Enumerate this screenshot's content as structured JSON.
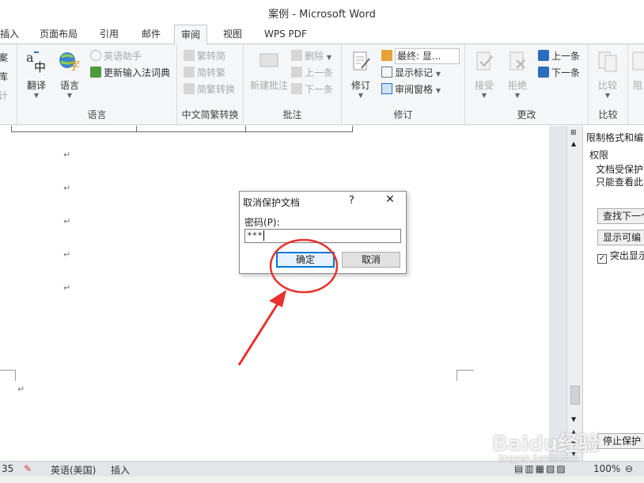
{
  "window": {
    "title": "案例 - Microsoft Word"
  },
  "tabs": [
    {
      "label": "插入"
    },
    {
      "label": "页面布局"
    },
    {
      "label": "引用"
    },
    {
      "label": "邮件"
    },
    {
      "label": "审阅"
    },
    {
      "label": "视图"
    },
    {
      "label": "WPS PDF"
    }
  ],
  "ribbon": {
    "left_cut": [
      "案",
      "库",
      "计"
    ],
    "language": {
      "label": "语言",
      "translate": "翻译",
      "language_btn": "语言",
      "english_assistant": "英语助手",
      "update_ime": "更新输入法词典"
    },
    "chinese": {
      "label": "中文简繁转换",
      "to_trad": "繁转简",
      "to_simp": "简转繁",
      "convert": "简繁转换"
    },
    "comments": {
      "label": "批注",
      "new": "新建批注",
      "delete": "删除",
      "prev": "上一条",
      "next": "下一条"
    },
    "tracking": {
      "label": "修订",
      "track": "修订",
      "display": "最终: 显...",
      "show_markup": "显示标记",
      "review_pane": "审阅窗格"
    },
    "changes": {
      "label": "更改",
      "accept": "接受",
      "reject": "拒绝",
      "prev": "上一条",
      "next": "下一条"
    },
    "compare": {
      "label": "比较",
      "compare_btn": "比较"
    },
    "protect_cut": "阻"
  },
  "pane": {
    "title": "限制格式和编辑",
    "section": "权限",
    "line1": "文档受保护",
    "line2": "只能查看此",
    "find_next": "查找下一个",
    "show_editable": "显示可编",
    "highlight": "突出显示",
    "stop_protect": "停止保护"
  },
  "status": {
    "page": "35",
    "lang": "英语(美国)",
    "mode": "插入",
    "zoom": "100%"
  },
  "dialog": {
    "title": "取消保护文档",
    "help": "?",
    "close": "✕",
    "password_label": "密码(P):",
    "password_value": "***",
    "ok": "确定",
    "cancel": "取消"
  },
  "watermark": {
    "brand": "Baidu经验",
    "site": "jingyan.baidu.com"
  },
  "colors": {
    "annotation": "#e8312f",
    "accent": "#0078d7"
  }
}
